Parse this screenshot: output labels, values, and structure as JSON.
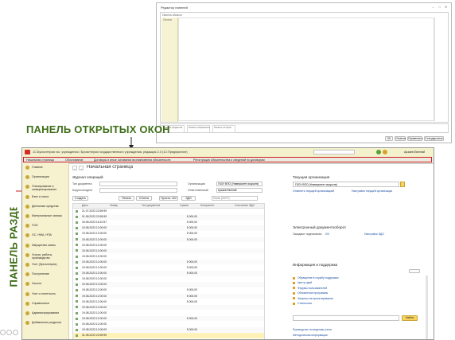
{
  "editor": {
    "title": "Редактор панелей",
    "sample_label": "Панель области",
    "left_label": "Панели",
    "bottom_panels": [
      "Панель разделов",
      "Панель избранного",
      "Панель истории"
    ],
    "footer_buttons": [
      "ОК",
      "Отмена",
      "Применить",
      "Стандартные"
    ]
  },
  "annotations": {
    "open_windows": "ПАНЕЛЬ ОТКРЫТЫХ ОКОН",
    "sections": "ПАНЕЛЬ РАЗДЕЛОВ"
  },
  "app": {
    "title": "1С:Бухгалтерия гос. учреждения / Бухгалтерия государственного учреждения, редакция 2.0 (1С:Предприятие)",
    "user": "Арзаев Евгений",
    "tabs": [
      "Начальная страница",
      "Обоснование",
      "Договоры и иные основания возникновения обязательств",
      "Регистрация обязательства и сведений по договорам"
    ],
    "sidebar": [
      "Главное",
      "Организация",
      "Планирование и санкционирование",
      "Банк и касса",
      "Денежные средства",
      "Материальные запасы",
      "ГСМ",
      "ОС, НМА, НПА",
      "Имущество казны",
      "Услуги, работы, производство",
      "Учет (бухгалтерия)",
      "Поступление",
      "Налоги",
      "Учет и отчетность",
      "Справочники",
      "Администрирование",
      "Добавление разделов"
    ],
    "page_title": "Начальная страница",
    "journal": {
      "title": "Журнал операций",
      "doc_type_label": "Тип документа",
      "correspondent_label": "Корреспондент",
      "org_label": "Организация",
      "org_value": "ГБОУ ВПО (Университет искусств)",
      "responsible_label": "Ответственный",
      "responsible_value": "Арзаев Евгений",
      "buttons": [
        "Создать",
        "Печать",
        "Отчеты",
        "Просто: 322",
        "ЭДО"
      ],
      "search_placeholder": "Поиск (Ctrl+F)",
      "columns": [
        "Дата",
        "Номер",
        "Тип документа",
        "Сумма",
        "Контрагент",
        "Состояние ЭДО"
      ],
      "rows": [
        {
          "date": "21.07.2023 23:59:59",
          "num": "",
          "type": "",
          "sum": "",
          "agent": ""
        },
        {
          "date": "01.08.2023 23:59:59",
          "num": "",
          "type": "",
          "sum": "5 000,00",
          "agent": ""
        },
        {
          "date": "18.08.2023 16:10:57",
          "num": "",
          "type": "",
          "sum": "5 000,00",
          "agent": ""
        },
        {
          "date": "19.08.2023 12:00:00",
          "num": "",
          "type": "",
          "sum": "5 000,00",
          "agent": ""
        },
        {
          "date": "19.08.2023 12:00:00",
          "num": "",
          "type": "",
          "sum": "5 000,00",
          "agent": ""
        },
        {
          "date": "19.08.2023 12:00:00",
          "num": "",
          "type": "",
          "sum": "5 000,00",
          "agent": ""
        },
        {
          "date": "19.08.2023 12:00:00",
          "num": "",
          "type": "",
          "sum": "",
          "agent": ""
        },
        {
          "date": "19.08.2023 12:00:00",
          "num": "",
          "type": "",
          "sum": "",
          "agent": ""
        },
        {
          "date": "19.08.2023 12:00:00",
          "num": "",
          "type": "",
          "sum": "",
          "agent": ""
        },
        {
          "date": "19.08.2023 12:00:00",
          "num": "",
          "type": "",
          "sum": "5 000,00",
          "agent": ""
        },
        {
          "date": "19.08.2023 12:00:00",
          "num": "",
          "type": "",
          "sum": "5 000,00",
          "agent": ""
        },
        {
          "date": "19.08.2023 12:00:00",
          "num": "",
          "type": "",
          "sum": "5 000,00",
          "agent": ""
        },
        {
          "date": "19.08.2023 12:00:00",
          "num": "",
          "type": "",
          "sum": "",
          "agent": ""
        },
        {
          "date": "19.08.2023 12:00:00",
          "num": "",
          "type": "",
          "sum": "",
          "agent": ""
        },
        {
          "date": "19.08.2023 12:00:00",
          "num": "",
          "type": "",
          "sum": "5 000,00",
          "agent": ""
        },
        {
          "date": "19.08.2023 12:00:00",
          "num": "",
          "type": "",
          "sum": "5 000,00",
          "agent": ""
        },
        {
          "date": "19.08.2023 12:00:00",
          "num": "",
          "type": "",
          "sum": "5 000,00",
          "agent": ""
        },
        {
          "date": "19.08.2023 12:00:00",
          "num": "",
          "type": "",
          "sum": "",
          "agent": ""
        },
        {
          "date": "19.08.2023 12:00:00",
          "num": "",
          "type": "",
          "sum": "",
          "agent": ""
        },
        {
          "date": "19.08.2023 12:00:00",
          "num": "",
          "type": "",
          "sum": "5 000,00",
          "agent": ""
        },
        {
          "date": "19.08.2023 12:00:00",
          "num": "",
          "type": "",
          "sum": "",
          "agent": ""
        },
        {
          "date": "19.08.2023 12:00:00",
          "num": "",
          "type": "",
          "sum": "5 000,00",
          "agent": ""
        },
        {
          "date": "31.08.2023 23:59:59",
          "num": "",
          "type": "",
          "sum": "",
          "agent": ""
        }
      ]
    },
    "current_org": {
      "title": "Текущая организация",
      "value": "ГБОУ ВПО (Университет искусств)",
      "link1": "Отменить текущей организацией",
      "link2": "Настройки текущей организации"
    },
    "edo": {
      "title": "Электронный документооборот",
      "label": "Ожидают подписания:",
      "count": "0/0",
      "link": "Настройки ЭДО"
    },
    "info": {
      "title": "Информация и поддержка",
      "links": [
        "Обращение в службу поддержки",
        "Центр идей",
        "Форумы пользователей",
        "Обновление программы",
        "Запросы на проектирование",
        "Статистика"
      ],
      "search_button": "Найти",
      "footer_links": [
        "Руководство по ведению учета",
        "Методическая информация"
      ]
    }
  }
}
